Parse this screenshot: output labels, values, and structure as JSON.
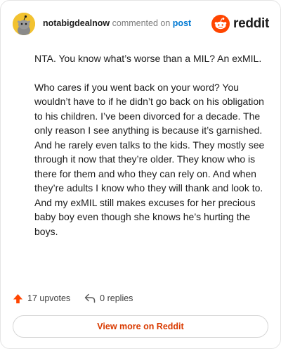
{
  "header": {
    "username": "notabigdealnow",
    "verb": "commented on",
    "post_type": "post",
    "logo_text": "reddit"
  },
  "comment": {
    "paragraphs": [
      "NTA. You know what’s worse than a MIL? An exMIL.",
      "Who cares if you went back on your word? You wouldn’t have to if he didn’t go back on his obligation to his children. I’ve been divorced for a decade. The only reason I see anything is because it’s garnished. And he rarely even talks to the kids. They mostly see through it now that they’re older. They know who is there for them and who they can rely on. And when they’re adults I know who they will thank and look to. And my exMIL still makes excuses for her precious baby boy even though she knows he’s hurting the boys."
    ]
  },
  "footer": {
    "upvotes_label": "17 upvotes",
    "replies_label": "0 replies"
  },
  "view_more_label": "View more on Reddit",
  "colors": {
    "brand": "#ff4500",
    "link": "#0079d3",
    "button_text": "#d93a00",
    "avatar_bg": "#f2c230"
  },
  "icons": {
    "avatar": "snoo-avatar",
    "logo": "reddit-snoo-icon",
    "upvote": "upvote-arrow-icon",
    "reply": "reply-arrow-icon"
  }
}
